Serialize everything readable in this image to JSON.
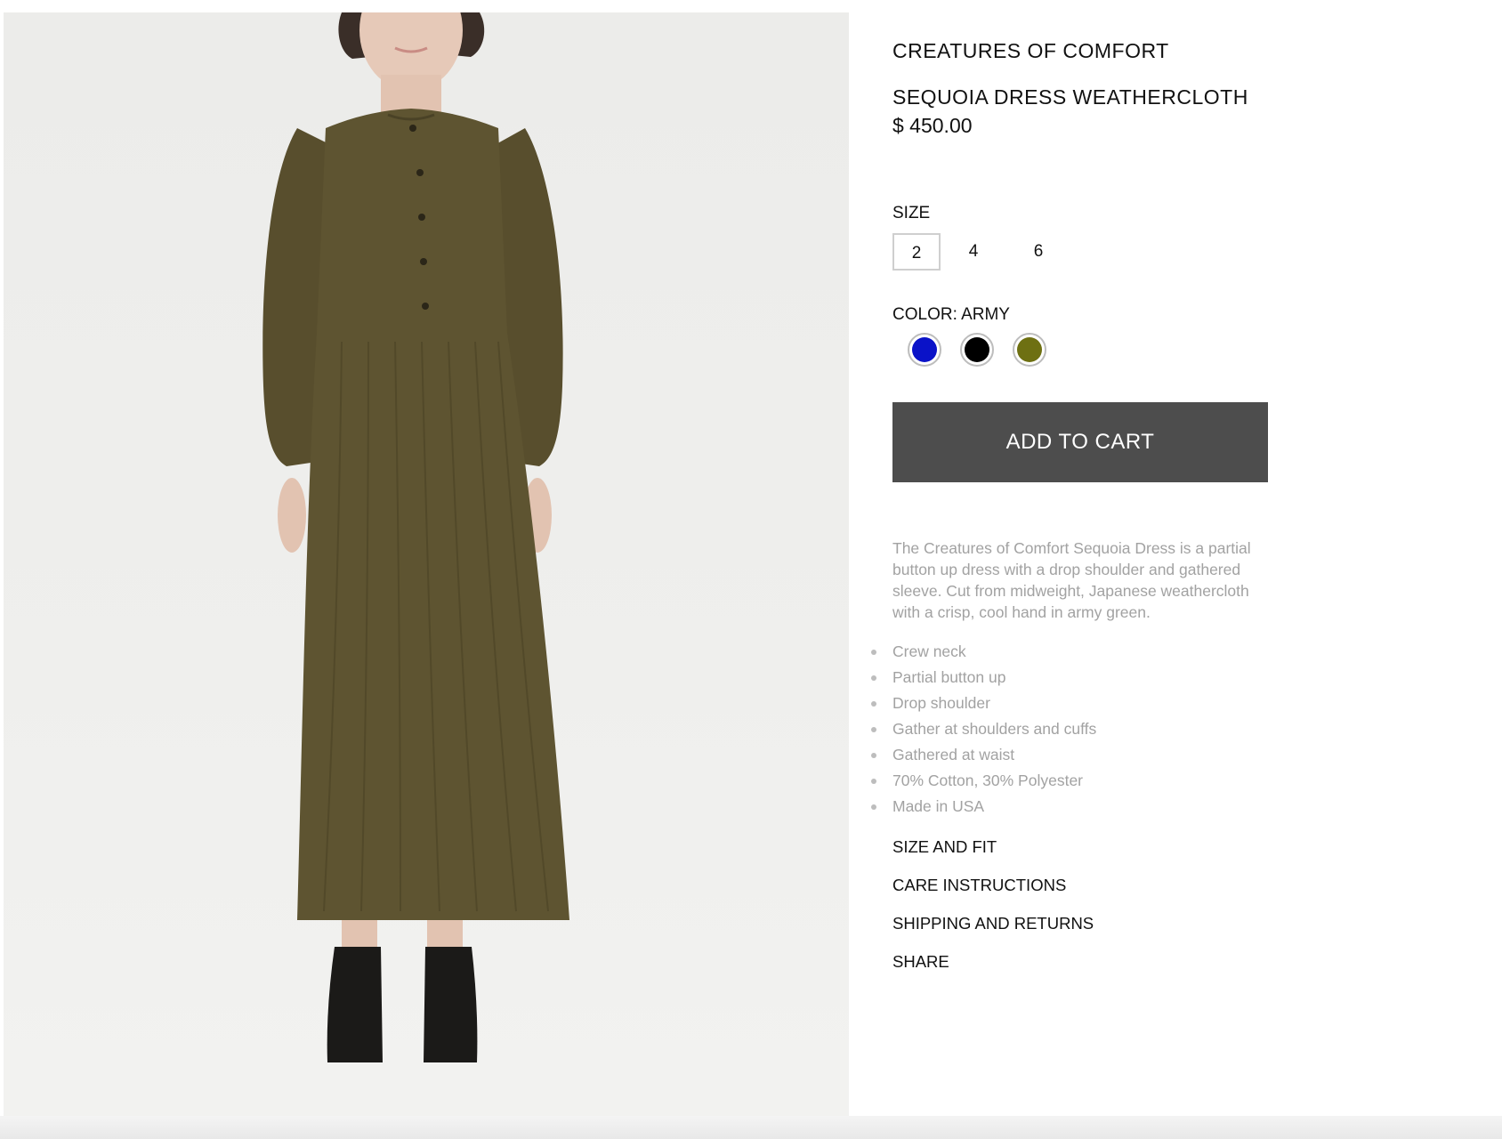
{
  "product": {
    "brand": "CREATURES OF COMFORT",
    "name": "SEQUOIA DRESS WEATHERCLOTH",
    "price": "$ 450.00",
    "image_alt": "Model wearing army green long dress with black boots"
  },
  "size": {
    "label": "SIZE",
    "options": [
      "2",
      "4",
      "6"
    ],
    "selected": "2"
  },
  "color": {
    "label": "COLOR: ARMY",
    "swatches": [
      {
        "name": "Blue",
        "hex": "#0a12c8"
      },
      {
        "name": "Black",
        "hex": "#000000"
      },
      {
        "name": "Army",
        "hex": "#6e7012"
      }
    ],
    "selected": "Army"
  },
  "cart": {
    "label": "ADD TO CART"
  },
  "description": "The Creatures of Comfort Sequoia Dress is a partial button up dress with a drop shoulder and gathered sleeve. Cut from midweight, Japanese weathercloth with a crisp, cool hand in army green.",
  "features": [
    "Crew neck",
    "Partial button up",
    "Drop shoulder",
    "Gather at shoulders and cuffs",
    "Gathered at waist",
    "70% Cotton, 30% Polyester",
    "Made in USA"
  ],
  "links": [
    "SIZE AND FIT",
    "CARE INSTRUCTIONS",
    "SHIPPING AND RETURNS",
    "SHARE"
  ],
  "colors": {
    "dress": "#5e5431",
    "button_bg": "#4d4d4d",
    "muted_text": "#a2a2a2"
  }
}
